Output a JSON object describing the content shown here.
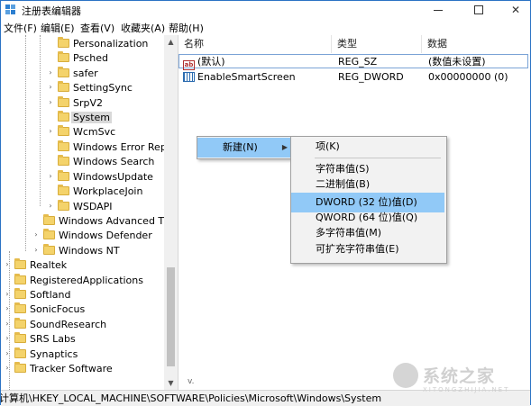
{
  "window": {
    "title": "注册表编辑器"
  },
  "menu": [
    "文件(F)",
    "编辑(E)",
    "查看(V)",
    "收藏夹(A)",
    "帮助(H)"
  ],
  "tree": {
    "items": [
      {
        "label": "Personalization",
        "expandable": false
      },
      {
        "label": "Psched",
        "expandable": false
      },
      {
        "label": "safer",
        "expandable": true
      },
      {
        "label": "SettingSync",
        "expandable": true
      },
      {
        "label": "SrpV2",
        "expandable": true
      },
      {
        "label": "System",
        "expandable": false,
        "selected": true
      },
      {
        "label": "WcmSvc",
        "expandable": true
      },
      {
        "label": "Windows Error Repo",
        "expandable": false
      },
      {
        "label": "Windows Search",
        "expandable": false
      },
      {
        "label": "WindowsUpdate",
        "expandable": true
      },
      {
        "label": "WorkplaceJoin",
        "expandable": false
      },
      {
        "label": "WSDAPI",
        "expandable": true
      },
      {
        "label": "Windows Advanced Thre",
        "expandable": false
      },
      {
        "label": "Windows Defender",
        "expandable": true
      },
      {
        "label": "Windows NT",
        "expandable": true
      },
      {
        "label": "Realtek",
        "expandable": true
      },
      {
        "label": "RegisteredApplications",
        "expandable": false
      },
      {
        "label": "Softland",
        "expandable": true
      },
      {
        "label": "SonicFocus",
        "expandable": true
      },
      {
        "label": "SoundResearch",
        "expandable": true
      },
      {
        "label": "SRS Labs",
        "expandable": true
      },
      {
        "label": "Synaptics",
        "expandable": true
      },
      {
        "label": "Tracker Software",
        "expandable": true
      }
    ]
  },
  "list": {
    "columns": [
      "名称",
      "类型",
      "数据"
    ],
    "rows": [
      {
        "name": "(默认)",
        "type": "REG_SZ",
        "data": "(数值未设置)",
        "icon": "string-value-icon"
      },
      {
        "name": "EnableSmartScreen",
        "type": "REG_DWORD",
        "data": "0x00000000 (0)",
        "icon": "binary-value-icon"
      }
    ]
  },
  "context_menu": {
    "new_label": "新建(N)"
  },
  "submenu": {
    "items": [
      {
        "label": "项(K)"
      },
      {
        "separator": true
      },
      {
        "label": "字符串值(S)"
      },
      {
        "label": "二进制值(B)"
      },
      {
        "label": "DWORD (32 位)值(D)",
        "highlighted": true
      },
      {
        "label": "QWORD (64 位)值(Q)"
      },
      {
        "label": "多字符串值(M)"
      },
      {
        "label": "可扩充字符串值(E)"
      }
    ]
  },
  "statusbar": {
    "path": "计算机\\HKEY_LOCAL_MACHINE\\SOFTWARE\\Policies\\Microsoft\\Windows\\System"
  },
  "list_mark": "v.",
  "colors": {
    "accent": "#2b73c4",
    "highlight": "#91c9f7",
    "folder": "#f4d36b"
  }
}
